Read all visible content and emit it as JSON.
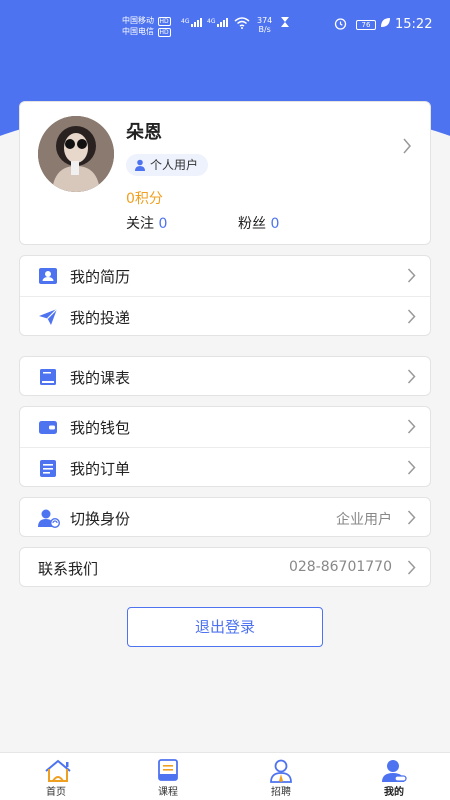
{
  "status_bar": {
    "carrier1": "中国移动",
    "carrier2": "中国电信",
    "hd": "HD",
    "net1": "4G",
    "net2": "4G",
    "speed_value": "374",
    "speed_unit": "B/s",
    "battery": "76",
    "time": "15:22"
  },
  "profile": {
    "name": "朵恩",
    "user_type": "个人用户",
    "points": "0积分",
    "follow_label": "关注",
    "follow_count": "0",
    "fans_label": "粉丝",
    "fans_count": "0"
  },
  "menu": {
    "resume": "我的简历",
    "delivery": "我的投递",
    "schedule": "我的课表",
    "wallet": "我的钱包",
    "orders": "我的订单",
    "switch_identity": "切换身份",
    "switch_identity_value": "企业用户",
    "contact": "联系我们",
    "contact_phone": "028-86701770"
  },
  "logout_label": "退出登录",
  "tabs": {
    "home": "首页",
    "courses": "课程",
    "jobs": "招聘",
    "mine": "我的"
  },
  "colors": {
    "accent": "#4e73f0",
    "points": "#f0a020",
    "background": "#f5f5f5"
  }
}
